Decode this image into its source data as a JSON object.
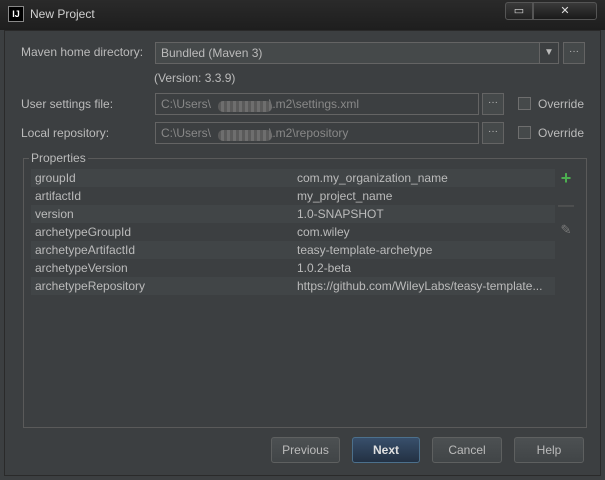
{
  "window": {
    "app_icon": "intellij-icon",
    "app_icon_text": "IJ",
    "title": "New Project",
    "restore_icon": "restore-window-icon",
    "restore_glyph": "▭",
    "close_icon": "close-icon",
    "close_glyph": "✕"
  },
  "maven": {
    "home_label": "Maven home directory:",
    "home_value": "Bundled (Maven 3)",
    "dropdown_glyph": "▼",
    "browse_glyph": "···",
    "version": "(Version: 3.3.9)"
  },
  "user_settings": {
    "label": "User settings file:",
    "value_prefix": "C:\\Users\\",
    "value_suffix": "\\.m2\\settings.xml",
    "browse_glyph": "···",
    "override_label": "Override"
  },
  "local_repo": {
    "label": "Local repository:",
    "value_prefix": "C:\\Users\\",
    "value_suffix": "\\.m2\\repository",
    "browse_glyph": "···",
    "override_label": "Override"
  },
  "properties": {
    "title": "Properties",
    "rows": [
      {
        "key": "groupId",
        "value": "com.my_organization_name"
      },
      {
        "key": "artifactId",
        "value": "my_project_name"
      },
      {
        "key": "version",
        "value": "1.0-SNAPSHOT"
      },
      {
        "key": "archetypeGroupId",
        "value": "com.wiley"
      },
      {
        "key": "archetypeArtifactId",
        "value": "teasy-template-archetype"
      },
      {
        "key": "archetypeVersion",
        "value": "1.0.2-beta"
      },
      {
        "key": "archetypeRepository",
        "value": "https://github.com/WileyLabs/teasy-template..."
      }
    ],
    "add_glyph": "+",
    "remove_glyph": "—",
    "edit_glyph": "✎"
  },
  "buttons": {
    "previous": "Previous",
    "next": "Next",
    "cancel": "Cancel",
    "help": "Help"
  },
  "colors": {
    "background": "#3c3f41",
    "add_accent": "#4caf50",
    "default_button": "#2f4560"
  }
}
